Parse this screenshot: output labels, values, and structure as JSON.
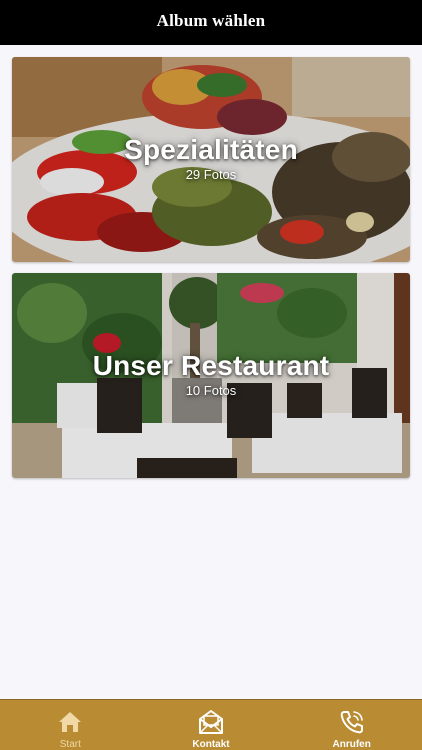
{
  "header": {
    "title": "Album wählen"
  },
  "albums": [
    {
      "title": "Spezialitäten",
      "count": "29 Fotos"
    },
    {
      "title": "Unser Restaurant",
      "count": "10 Fotos"
    }
  ],
  "tabs": [
    {
      "label": "Start",
      "icon": "home-icon"
    },
    {
      "label": "Kontakt",
      "icon": "envelope-icon"
    },
    {
      "label": "Anrufen",
      "icon": "phone-icon"
    }
  ],
  "colors": {
    "nav_bar": "#000000",
    "tab_bar": "#b98b33",
    "background": "#f7f6fa"
  }
}
